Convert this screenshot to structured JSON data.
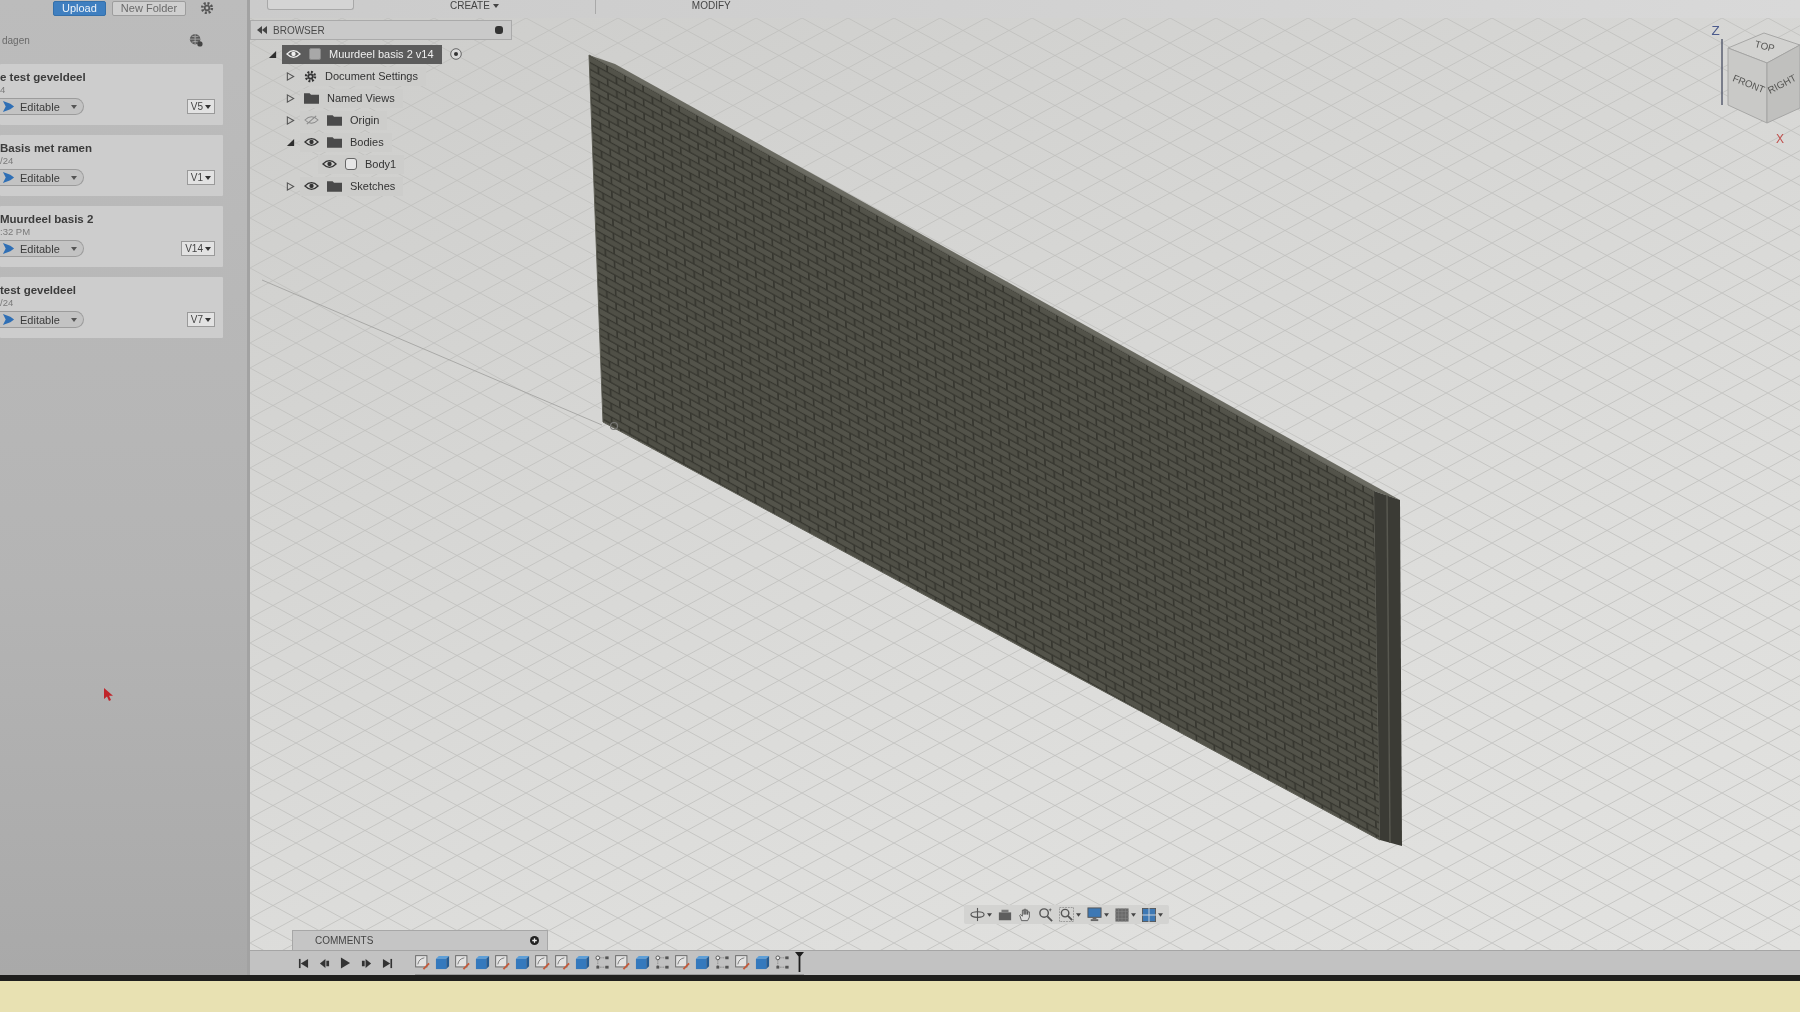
{
  "data_panel": {
    "buttons": [
      {
        "label": "Upload",
        "kind": "primary"
      },
      {
        "label": "New Folder",
        "kind": "secondary"
      }
    ],
    "filter_label": "dagen",
    "files": [
      {
        "title": "e test geveldeel",
        "date": "4",
        "status": "Editable",
        "version": "V5"
      },
      {
        "title": "Basis met ramen",
        "date": "/24",
        "status": "Editable",
        "version": "V1"
      },
      {
        "title": "Muurdeel basis 2",
        "date": ":32 PM",
        "status": "Editable",
        "version": "V14"
      },
      {
        "title": "test geveldeel",
        "date": "/24",
        "status": "Editable",
        "version": "V7"
      }
    ]
  },
  "toolbar": {
    "menus": [
      {
        "label": "CREATE",
        "caret": true
      },
      {
        "label": "MODIFY",
        "caret": false
      }
    ]
  },
  "browser": {
    "title": "BROWSER",
    "tree": [
      {
        "label": "Muurdeel basis 2 v14",
        "kind": "component",
        "expanded": true,
        "visible": true,
        "selected": true,
        "children": [
          {
            "label": "Document Settings",
            "kind": "settings",
            "expanded": false,
            "selected": false
          },
          {
            "label": "Named Views",
            "kind": "folder",
            "expanded": false,
            "selected": false
          },
          {
            "label": "Origin",
            "kind": "folder",
            "expanded": false,
            "visible": false,
            "selected": false
          },
          {
            "label": "Bodies",
            "kind": "folder",
            "expanded": true,
            "visible": true,
            "selected": false,
            "children": [
              {
                "label": "Body1",
                "kind": "body",
                "visible": true,
                "selected": false
              }
            ]
          },
          {
            "label": "Sketches",
            "kind": "folder",
            "expanded": false,
            "visible": true,
            "selected": false
          }
        ]
      }
    ]
  },
  "view_cube": {
    "faces": [
      "TOP",
      "FRONT",
      "RIGHT"
    ],
    "axes": [
      "Z",
      "X"
    ]
  },
  "comments": {
    "title": "COMMENTS"
  },
  "timeline": {
    "features": [
      {
        "kind": "sketch"
      },
      {
        "kind": "extrude"
      },
      {
        "kind": "sketch"
      },
      {
        "kind": "extrude"
      },
      {
        "kind": "sketch"
      },
      {
        "kind": "extrude"
      },
      {
        "kind": "sketch"
      },
      {
        "kind": "sketch"
      },
      {
        "kind": "extrude"
      },
      {
        "kind": "pattern"
      },
      {
        "kind": "sketch"
      },
      {
        "kind": "extrude"
      },
      {
        "kind": "pattern"
      },
      {
        "kind": "sketch"
      },
      {
        "kind": "extrude"
      },
      {
        "kind": "pattern"
      },
      {
        "kind": "sketch"
      },
      {
        "kind": "extrude"
      },
      {
        "kind": "pattern"
      }
    ]
  }
}
